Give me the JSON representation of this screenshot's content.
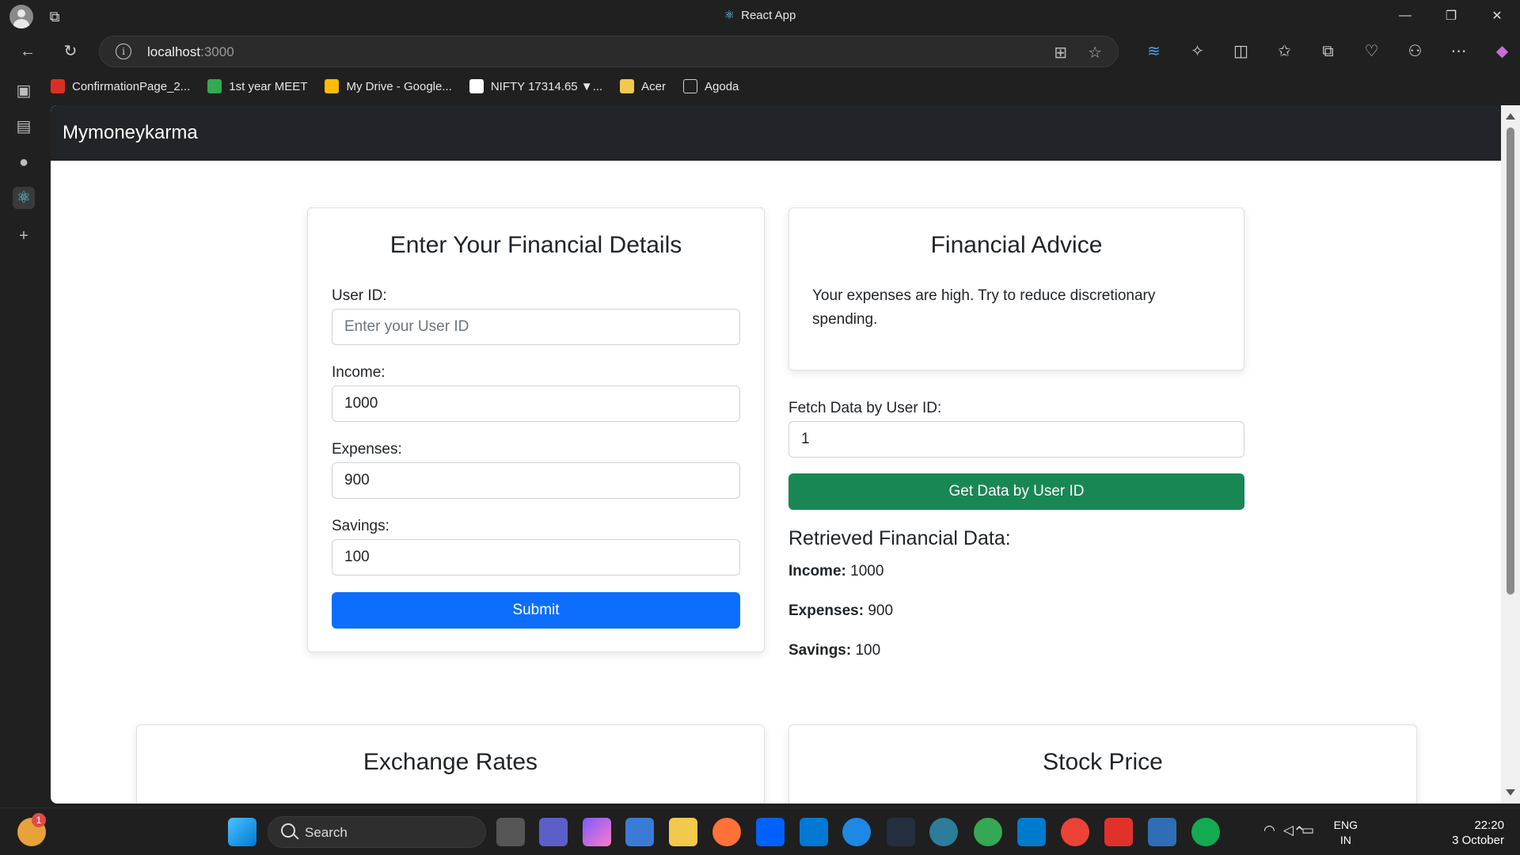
{
  "browser": {
    "window_title": "React App",
    "url_host": "localhost",
    "url_port": ":3000",
    "bookmarks": [
      {
        "label": "ConfirmationPage_2...",
        "color": "#d93025"
      },
      {
        "label": "1st year MEET",
        "color": "#34a853"
      },
      {
        "label": "My Drive - Google...",
        "color": "#fbbc04"
      },
      {
        "label": "NIFTY 17314.65 ▼...",
        "color": "#ffffff"
      },
      {
        "label": "Acer",
        "color": "#f2c94c"
      },
      {
        "label": "Agoda",
        "color": "#cfcfcf"
      }
    ]
  },
  "app": {
    "brand": "Mymoneykarma",
    "form": {
      "title": "Enter Your Financial Details",
      "user_id_label": "User ID:",
      "user_id_placeholder": "Enter your User ID",
      "income_label": "Income:",
      "income_value": "1000",
      "expenses_label": "Expenses:",
      "expenses_value": "900",
      "savings_label": "Savings:",
      "savings_value": "100",
      "submit_label": "Submit"
    },
    "advice": {
      "title": "Financial Advice",
      "text": "Your expenses are high. Try to reduce discretionary spending."
    },
    "fetch": {
      "label": "Fetch Data by User ID:",
      "value": "1",
      "button_label": "Get Data by User ID"
    },
    "retrieved": {
      "title": "Retrieved Financial Data:",
      "income_label": "Income:",
      "income_value": "1000",
      "expenses_label": "Expenses:",
      "expenses_value": "900",
      "savings_label": "Savings:",
      "savings_value": "100"
    },
    "exchange_title": "Exchange Rates",
    "stock_title": "Stock Price"
  },
  "taskbar": {
    "search_label": "Search",
    "notification_count": "1",
    "lang_line1": "ENG",
    "lang_line2": "IN",
    "time": "22:20",
    "date": "3 October"
  },
  "colors": {
    "primary": "#0d6efd",
    "success": "#198754",
    "navbar": "#212529"
  }
}
